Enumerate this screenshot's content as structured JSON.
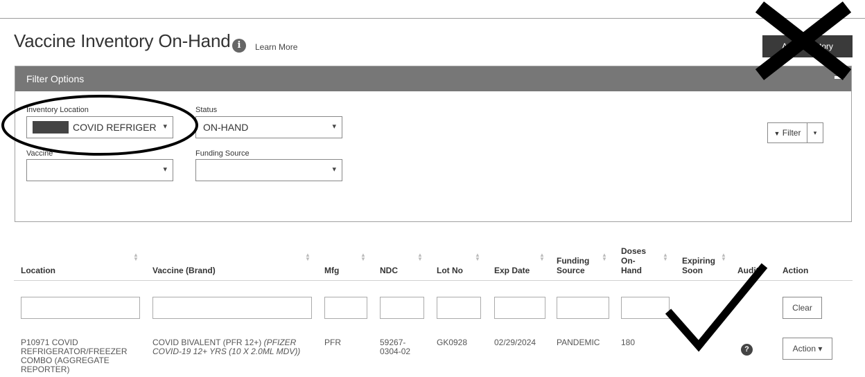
{
  "page": {
    "title": "Vaccine Inventory On-Hand",
    "info_icon": "i",
    "learn_more": "Learn More",
    "add_button": "Add Inventory"
  },
  "filter": {
    "header": "Filter Options",
    "location_label": "Inventory Location",
    "location_value": "COVID REFRIGER",
    "status_label": "Status",
    "status_value": "ON-HAND",
    "vaccine_label": "Vaccine",
    "vaccine_value": "",
    "funding_label": "Funding Source",
    "funding_value": "",
    "filter_button": "Filter",
    "dropdown_glyph": "▾",
    "filter_glyph": "▼"
  },
  "table": {
    "headers": {
      "location": "Location",
      "vaccine": "Vaccine (Brand)",
      "mfg": "Mfg",
      "ndc": "NDC",
      "lot": "Lot No",
      "exp": "Exp Date",
      "funding_1": "Funding",
      "funding_2": "Source",
      "doses_1": "Doses",
      "doses_2": "On-",
      "doses_3": "Hand",
      "expiring_1": "Expiring",
      "expiring_2": "Soon",
      "audit": "Audit",
      "action": "Action"
    },
    "clear_button": "Clear",
    "rows": [
      {
        "location": [
          "P10971 COVID",
          "REFRIGERATOR/FREEZER",
          "COMBO (AGGREGATE",
          "REPORTER)"
        ],
        "vaccine_plain": "COVID BIVALENT (PFR 12+)",
        "vaccine_italic_1": "(PFIZER",
        "vaccine_italic_2": "COVID-19 12+ YRS (10 X 2.0ML MDV))",
        "mfg": "PFR",
        "ndc_1": "59267-",
        "ndc_2": "0304-02",
        "lot": "GK0928",
        "exp": "02/29/2024",
        "funding": "PANDEMIC",
        "doses": "180",
        "audit_icon": "?",
        "action_button": "Action ▾"
      }
    ]
  },
  "icons": {
    "info": "info-icon",
    "collapse": "minus-icon",
    "chevron": "chevron-down-icon",
    "filter": "funnel-icon",
    "sort": "sort-icon",
    "help": "question-icon"
  },
  "annotations": {
    "ellipse": "hand-drawn oval around inventory location",
    "cross": "large X mark",
    "check": "large check mark"
  }
}
